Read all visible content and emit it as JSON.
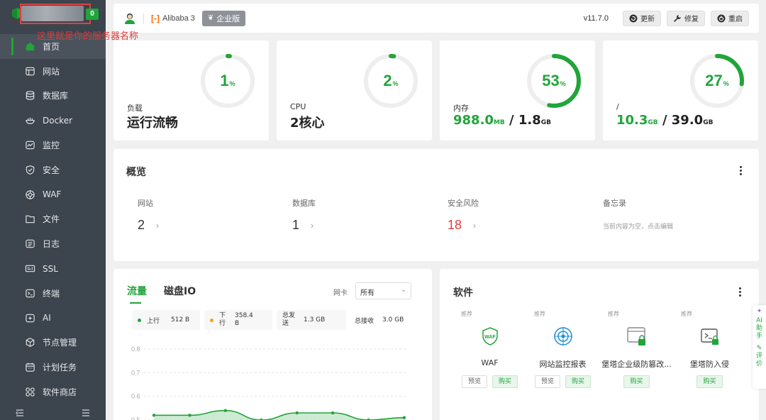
{
  "sidebar": {
    "annotation": "这里就是你的服务器名称",
    "badge": "0",
    "items": [
      {
        "label": "首页",
        "icon": "home-icon",
        "active": true
      },
      {
        "label": "网站",
        "icon": "website-icon"
      },
      {
        "label": "数据库",
        "icon": "database-icon"
      },
      {
        "label": "Docker",
        "icon": "docker-icon"
      },
      {
        "label": "监控",
        "icon": "monitor-icon"
      },
      {
        "label": "安全",
        "icon": "shield-icon"
      },
      {
        "label": "WAF",
        "icon": "waf-icon"
      },
      {
        "label": "文件",
        "icon": "folder-icon"
      },
      {
        "label": "日志",
        "icon": "log-icon"
      },
      {
        "label": "SSL",
        "icon": "ssl-icon"
      },
      {
        "label": "终端",
        "icon": "terminal-icon"
      },
      {
        "label": "AI",
        "icon": "ai-icon"
      },
      {
        "label": "节点管理",
        "icon": "node-icon"
      },
      {
        "label": "计划任务",
        "icon": "calendar-icon"
      },
      {
        "label": "软件商店",
        "icon": "store-icon"
      }
    ]
  },
  "topbar": {
    "os_name": "Alibaba 3",
    "edition": "企业版",
    "version": "v11.7.0",
    "update_label": "更新",
    "repair_label": "修复",
    "restart_label": "重启"
  },
  "stats": [
    {
      "label": "负载",
      "value": "运行流畅",
      "percent": 1
    },
    {
      "label": "CPU",
      "value": "2核心",
      "percent": 2
    },
    {
      "label": "内存",
      "used": "988.0",
      "used_unit": "MB",
      "total": "1.8",
      "total_unit": "GB",
      "percent": 53
    },
    {
      "label": "/",
      "used": "10.3",
      "used_unit": "GB",
      "total": "39.0",
      "total_unit": "GB",
      "percent": 27
    }
  ],
  "overview": {
    "title": "概览",
    "items": [
      {
        "label": "网站",
        "value": "2"
      },
      {
        "label": "数据库",
        "value": "1"
      },
      {
        "label": "安全风险",
        "value": "18"
      },
      {
        "label": "备忘录",
        "placeholder": "当前内容为空，点击编辑"
      }
    ]
  },
  "traffic": {
    "tabs": [
      "流量",
      "磁盘IO"
    ],
    "nic_label": "网卡",
    "nic_value": "所有",
    "up_label": "上行",
    "up_value": "512 B",
    "down_label": "下行",
    "down_value": "358.4 B",
    "total_sent_label": "总发送",
    "total_sent_value": "1.3 GB",
    "total_recv_label": "总接收",
    "total_recv_value": "3.0 GB",
    "colors": {
      "up": "#20a53a",
      "down": "#f0a020"
    }
  },
  "chart_data": {
    "type": "area",
    "yticks": [
      "0.8",
      "0.7",
      "0.6",
      "0.5"
    ],
    "ylim": [
      0.5,
      0.8
    ],
    "series": [
      {
        "values": [
          0.52,
          0.52,
          0.54,
          0.5,
          0.53,
          0.53,
          0.5,
          0.51
        ]
      }
    ]
  },
  "software": {
    "title": "软件",
    "items": [
      {
        "tag": "推荐",
        "name": "WAF",
        "icon": "waf-shield-icon",
        "preview": "预览",
        "buy": "购买"
      },
      {
        "tag": "推荐",
        "name": "网站监控报表",
        "icon": "radar-icon",
        "preview": "预览",
        "buy": "购买"
      },
      {
        "tag": "推荐",
        "name": "堡塔企业级防篡改...",
        "icon": "tamper-lock-icon",
        "buy": "购买"
      },
      {
        "tag": "推荐",
        "name": "堡塔防入侵",
        "icon": "intrusion-terminal-icon",
        "buy": "购买"
      }
    ]
  },
  "float_widget": {
    "ai_text": "AI助手",
    "review_text": "评价"
  }
}
